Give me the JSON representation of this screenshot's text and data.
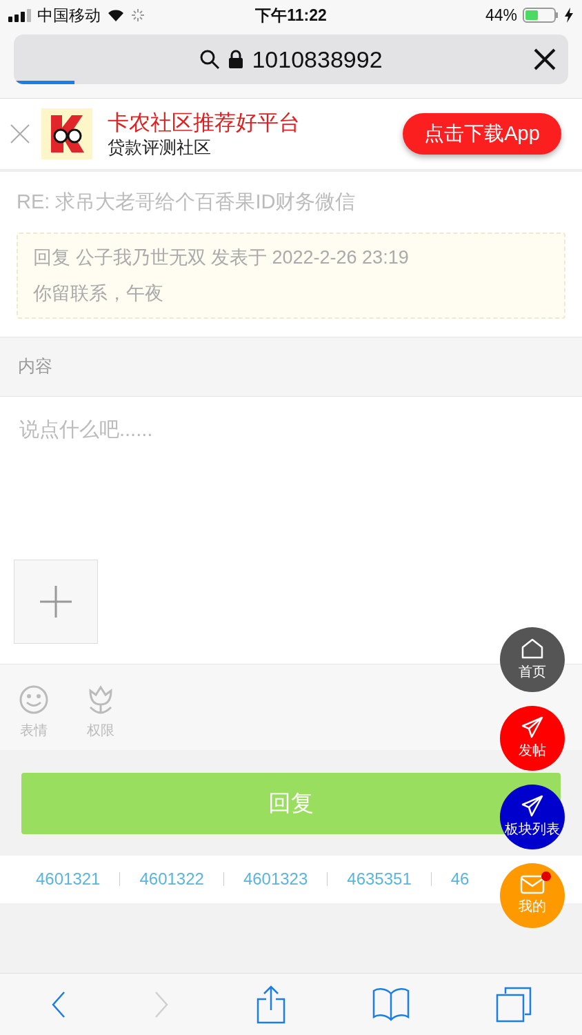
{
  "status_bar": {
    "carrier": "中国移动",
    "time": "下午11:22",
    "battery": "44%"
  },
  "url_bar": {
    "address": "1010838992",
    "progress": {
      "level": 0.11
    }
  },
  "banner": {
    "title": "卡农社区推荐好平台",
    "subtitle": "贷款评测社区",
    "button": "点击下载App"
  },
  "post": {
    "title": "RE: 求吊大老哥给个百香果ID财务微信",
    "quote_header": "回复 公子我乃世无双 发表于 2022-2-26 23:19",
    "quote_body": "你留联系，午夜"
  },
  "editor": {
    "section_label": "内容",
    "placeholder": "说点什么吧......"
  },
  "tools": [
    {
      "kind": "emoji",
      "label": "表情"
    },
    {
      "kind": "permission",
      "label": "权限"
    }
  ],
  "reply_button": "回复",
  "links": [
    "4601321",
    "4601322",
    "4601323",
    "4635351",
    "46"
  ],
  "floating": [
    {
      "kind": "home",
      "label": "首页",
      "color": "#555555",
      "badge": false
    },
    {
      "kind": "send",
      "label": "发帖",
      "color": "#ff0000",
      "badge": false
    },
    {
      "kind": "send",
      "label": "板块列表",
      "color": "#0000cc",
      "badge": false
    },
    {
      "kind": "mail",
      "label": "我的",
      "color": "#ff9900",
      "badge": true
    }
  ],
  "browser_toolbar": [
    {
      "kind": "back",
      "disabled": false
    },
    {
      "kind": "forward",
      "disabled": true
    },
    {
      "kind": "share",
      "disabled": false
    },
    {
      "kind": "bookmarks",
      "disabled": false
    },
    {
      "kind": "tabs",
      "disabled": false
    }
  ]
}
